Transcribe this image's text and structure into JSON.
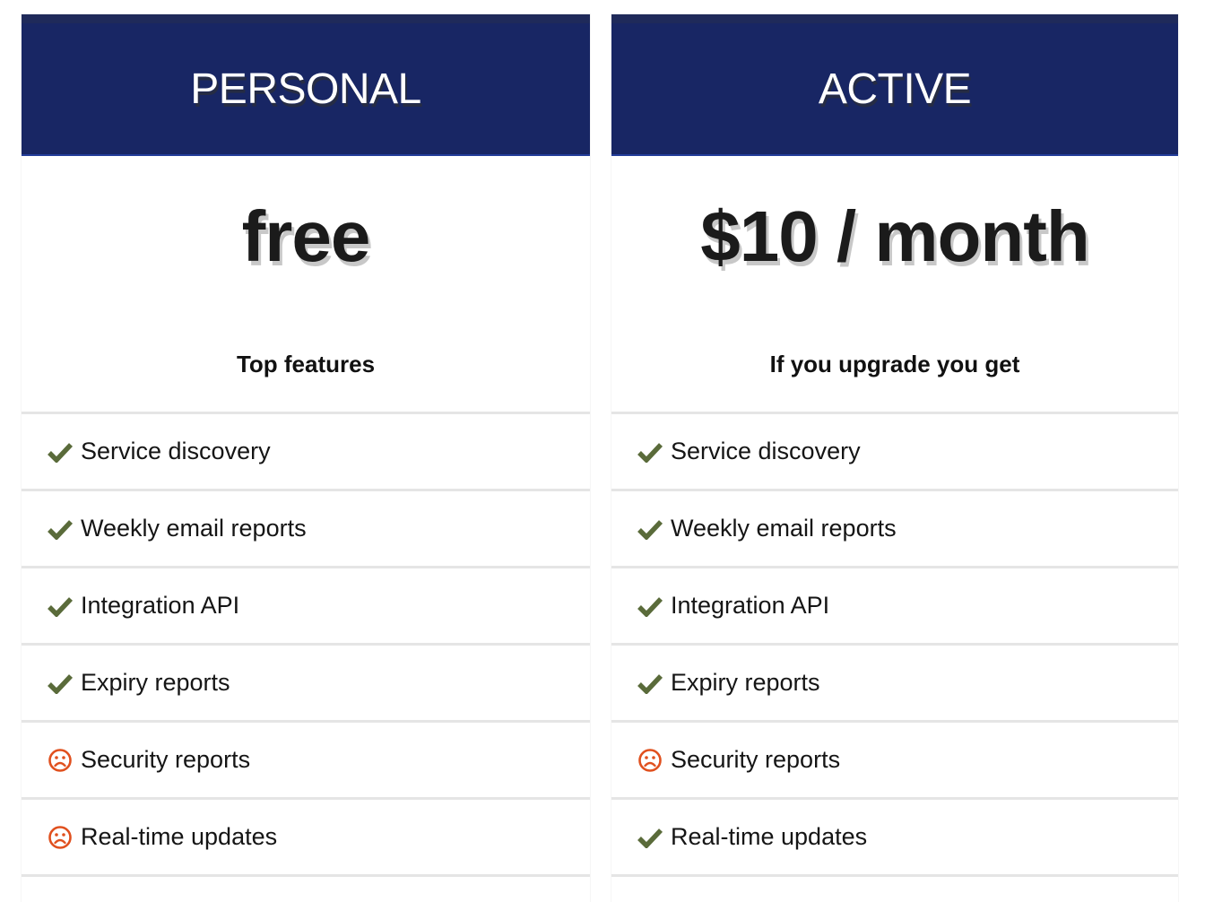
{
  "colors": {
    "header_bg": "#182664",
    "check": "#5a6b3a",
    "frown": "#e0501e"
  },
  "plans": [
    {
      "name": "PERSONAL",
      "price": "free",
      "subtitle": "Top features",
      "features": [
        {
          "label": "Service discovery",
          "icon": "check-icon",
          "included": true
        },
        {
          "label": "Weekly email reports",
          "icon": "check-icon",
          "included": true
        },
        {
          "label": "Integration API",
          "icon": "check-icon",
          "included": true
        },
        {
          "label": "Expiry reports",
          "icon": "check-icon",
          "included": true
        },
        {
          "label": "Security reports",
          "icon": "frown-icon",
          "included": false
        },
        {
          "label": "Real-time updates",
          "icon": "frown-icon",
          "included": false
        }
      ]
    },
    {
      "name": "ACTIVE",
      "price": "$10 / month",
      "subtitle": "If you upgrade you get",
      "features": [
        {
          "label": "Service discovery",
          "icon": "check-icon",
          "included": true
        },
        {
          "label": "Weekly email reports",
          "icon": "check-icon",
          "included": true
        },
        {
          "label": "Integration API",
          "icon": "check-icon",
          "included": true
        },
        {
          "label": "Expiry reports",
          "icon": "check-icon",
          "included": true
        },
        {
          "label": "Security reports",
          "icon": "frown-icon",
          "included": false
        },
        {
          "label": "Real-time updates",
          "icon": "check-icon",
          "included": true
        }
      ]
    }
  ]
}
